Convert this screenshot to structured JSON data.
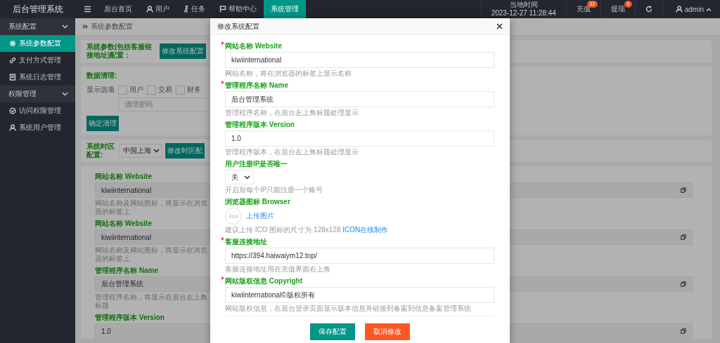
{
  "topbar": {
    "logo": "后台管理系统",
    "nav": [
      {
        "label": "后台首页",
        "selected": false
      },
      {
        "label": "用户",
        "selected": false
      },
      {
        "label": "任务",
        "selected": false
      },
      {
        "label": "帮助中心",
        "selected": false
      },
      {
        "label": "系统管理",
        "selected": true
      }
    ],
    "clock": {
      "label": "当地时间",
      "time": "2023-12-27 11:28:44"
    },
    "counters": [
      {
        "label": "充值",
        "badge": "32"
      },
      {
        "label": "提现",
        "badge": "0"
      }
    ],
    "user": "admin"
  },
  "sidebar": {
    "groups": [
      {
        "label": "系统配置",
        "expanded": true,
        "items": [
          {
            "label": "系统参数配置",
            "selected": true
          },
          {
            "label": "支付方式管理",
            "selected": false
          },
          {
            "label": "系统日志管理",
            "selected": false
          }
        ]
      },
      {
        "label": "权限管理",
        "expanded": true,
        "items": [
          {
            "label": "访问权限管理",
            "selected": false
          },
          {
            "label": "系统用户管理",
            "selected": false
          }
        ]
      }
    ]
  },
  "content": {
    "breadcrumb": "系统参数配置",
    "config_card": {
      "label": "系统参数(包括客服链接地址)配置：",
      "button": "修改系统配置"
    },
    "cleanup_card": {
      "title": "数据清理:",
      "options_label": "显示选项",
      "options": [
        {
          "label": "用户",
          "checked": false
        },
        {
          "label": "交易",
          "checked": false
        },
        {
          "label": "财务",
          "checked": false
        }
      ],
      "password_placeholder": "清理密码",
      "button": "确定清理"
    },
    "timezone_card": {
      "label": "系统时区配置:",
      "value": "中国上海",
      "button": "修改时区配"
    },
    "fields": [
      {
        "label": "网站名称 Website",
        "value": "kiwiinternational",
        "hint": "网站名称及网站图标，将显示在浏览器的标签上"
      },
      {
        "label": "网站名称 Website",
        "value": "kiwiinternational",
        "hint": "网站名称及网站图标，将显示在浏览器的标签上"
      },
      {
        "label": "管理程序名称 Name",
        "value": "后台管理系统",
        "hint": "管理程序名称，将显示在后台左上角标题"
      },
      {
        "label": "管理程序版本 Version",
        "value": "1.0"
      }
    ]
  },
  "modal": {
    "title": "修改系统配置",
    "fields": [
      {
        "kind": "text",
        "required": true,
        "label": "网站名称 Website",
        "value": "kiwiinternational",
        "hint": "网站名称，将在浏览器的标签上显示名称"
      },
      {
        "kind": "text",
        "required": true,
        "label": "管理程序名称 Name",
        "value": "后台管理系统",
        "hint": "管理程序名称，在后台左上角标题处理显示"
      },
      {
        "kind": "text",
        "required": false,
        "label": "管理程序版本 Version",
        "value": "1.0",
        "hint": "管理程序版本，在后台左上角标题处理显示"
      },
      {
        "kind": "select",
        "required": false,
        "label": "用户注册IP是否唯一",
        "value": "关",
        "hint": "开启后每个IP只能注册一个账号"
      },
      {
        "kind": "upload",
        "required": false,
        "label": "浏览器图标 Browser",
        "image_text": "404",
        "link": "上传图片",
        "hint": "建议上传 ICO 图标的尺寸为 128x128 ",
        "hint_link": "ICON在线制作"
      },
      {
        "kind": "text",
        "required": true,
        "label": "客服连接地址",
        "value": "https://394.haiwaiym12.top/",
        "hint": "客服连接地址用在充值界面右上角"
      },
      {
        "kind": "text",
        "required": true,
        "label": "网站版权信息 Copyright",
        "value": "kiwiinternational©版权所有",
        "hint": "网站版权信息，在后台登录页面显示版本信息并链接到备案到信息备案管理系统"
      }
    ],
    "buttons": [
      {
        "label": "保存配置",
        "kind": "primary"
      },
      {
        "label": "取消修改",
        "kind": "danger"
      }
    ]
  }
}
